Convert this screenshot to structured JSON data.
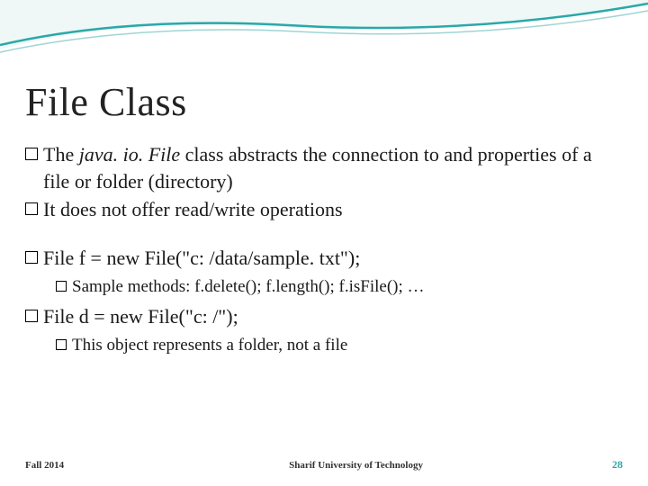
{
  "title": "File Class",
  "bullets": {
    "b1_pre": "The ",
    "b1_italic": "java. io. File",
    "b1_post": " class abstracts the connection to and properties of a file or folder (directory)",
    "b2": "It does not offer read/write operations",
    "b3": "File f = new File(\"c: /data/sample. txt\");",
    "b3a": "Sample methods: f.delete(); f.length(); f.isFile(); …",
    "b4": "File d = new File(\"c: /\");",
    "b4a": "This object represents a folder, not a file"
  },
  "footer": {
    "left": "Fall 2014",
    "center": "Sharif University of Technology",
    "right": "28"
  }
}
